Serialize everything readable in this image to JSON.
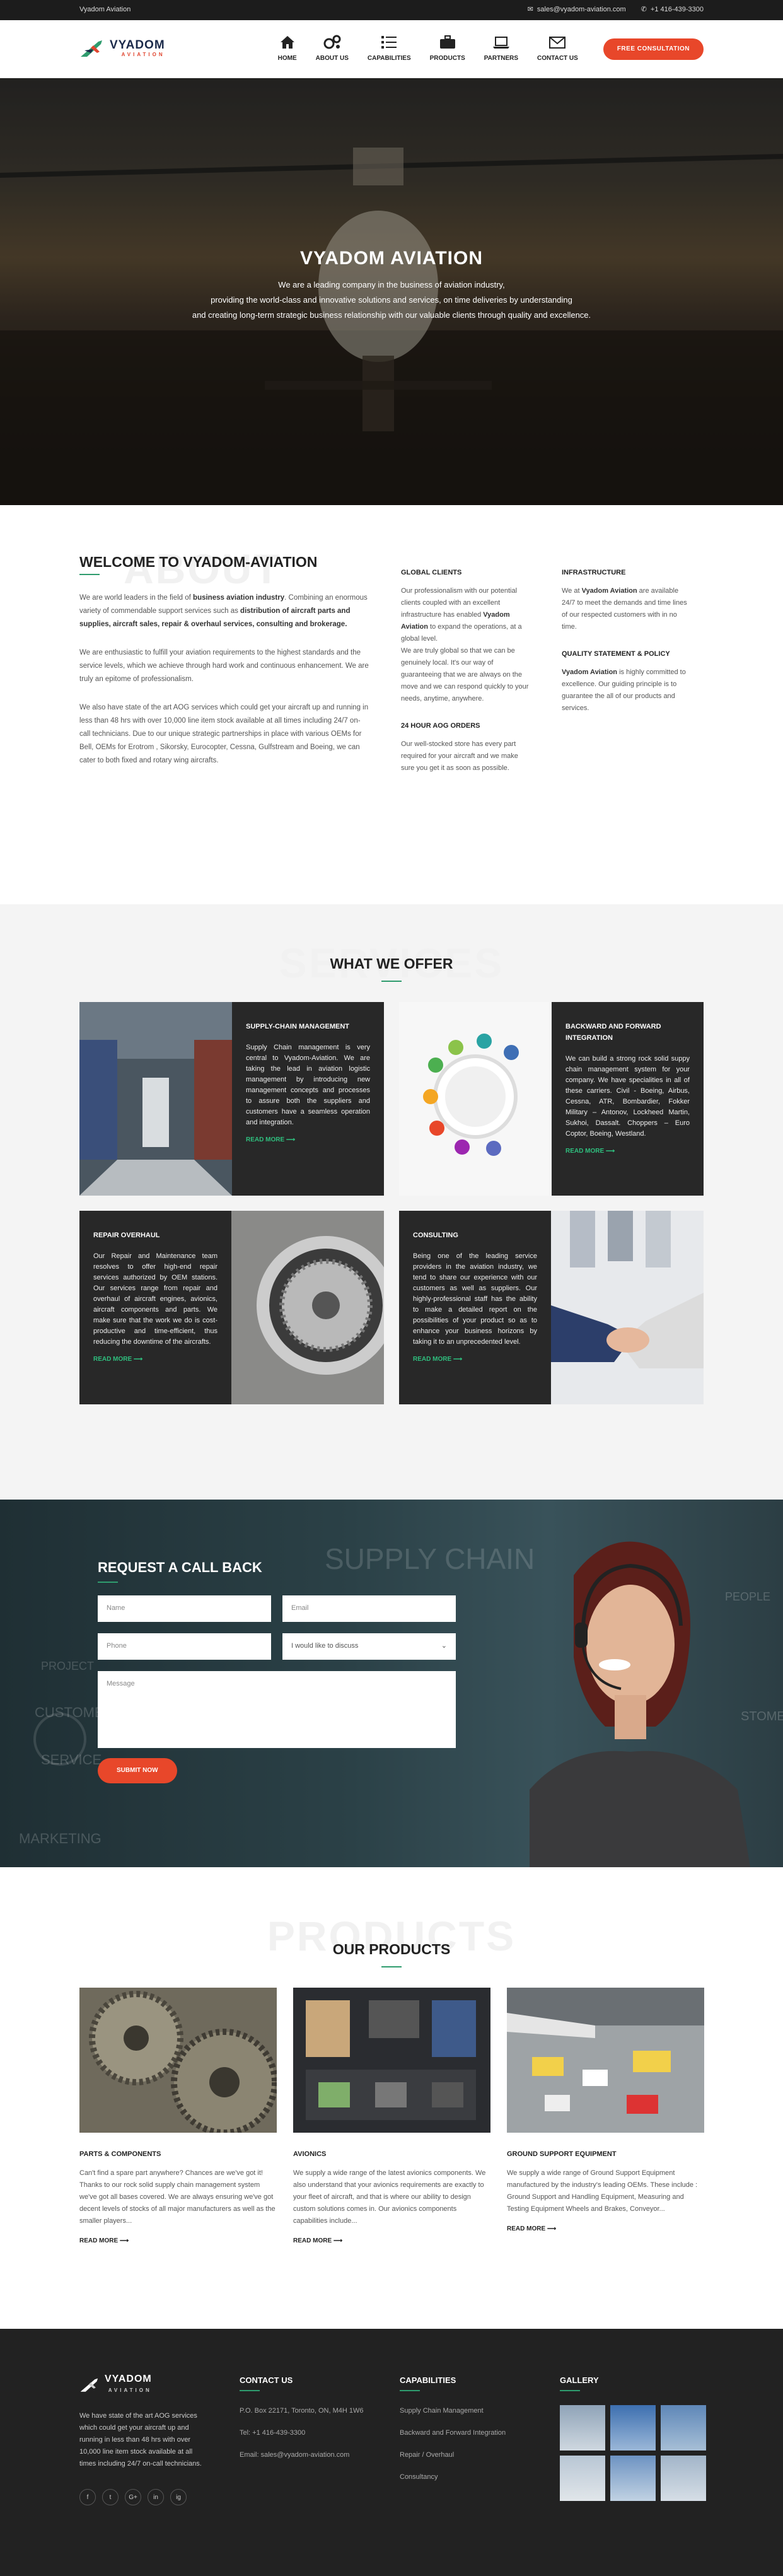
{
  "topbar": {
    "brand": "Vyadom Aviation",
    "email": "sales@vyadom-aviation.com",
    "phone": "+1 416-439-3300"
  },
  "nav": {
    "logo_word": "VYADOM",
    "logo_sub": "AVIATION",
    "items": [
      {
        "label": "HOME",
        "icon": "home-icon"
      },
      {
        "label": "ABOUT US",
        "icon": "gears-icon"
      },
      {
        "label": "CAPABILITIES",
        "icon": "list-icon"
      },
      {
        "label": "PRODUCTS",
        "icon": "briefcase-icon"
      },
      {
        "label": "PARTNERS",
        "icon": "laptop-icon"
      },
      {
        "label": "CONTACT US",
        "icon": "envelope-icon"
      }
    ],
    "cta": "FREE CONSULTATION"
  },
  "hero": {
    "title": "VYADOM AVIATION",
    "line1": "We are a leading company in the business of aviation industry,",
    "line2": "providing the world-class and innovative solutions and services, on time deliveries by understanding",
    "line3": "and creating long-term strategic business relationship with our valuable clients through quality and excellence."
  },
  "welcome": {
    "ghost": "ABOUT",
    "title": "WELCOME TO VYADOM-AVIATION",
    "p1_a": "We are world leaders in the field of ",
    "p1_b": "business aviation industry",
    "p1_c": ". Combining an enormous variety of commendable support services such as ",
    "p1_d": "distribution of aircraft parts and supplies, aircraft sales, repair & overhaul services, consulting and brokerage.",
    "p2": "We are enthusiastic to fulfill your aviation requirements to the highest standards and the service levels, which we achieve through hard work and continuous enhancement. We are truly an epitome of professionalism.",
    "p3": "We also have state of the art AOG services which could get your aircraft up and running in less than 48 hrs with over 10,000 line item stock available at all times including 24/7 on-call technicians. Due to our unique strategic partnerships in place with various OEMs for Bell, OEMs for Erotrom , Sikorsky, Eurocopter, Cessna, Gulfstream and Boeing, we can cater to both fixed and rotary wing aircrafts.",
    "global_title": "GLOBAL CLIENTS",
    "global_a": "Our professionalism with our potential clients coupled with an excellent infrastructure has enabled ",
    "global_b": "Vyadom Aviation",
    "global_c": " to expand the operations, at a global level.",
    "global_d": "We are truly global so that we can be genuinely local. It's our way of guaranteeing that we are always on the move and we can respond quickly to your needs, anytime, anywhere.",
    "aog_title": "24 HOUR AOG ORDERS",
    "aog_text": "Our well-stocked store has every part required for your aircraft and we make sure you get it as soon as possible.",
    "infra_title": "INFRASTRUCTURE",
    "infra_a": "We at ",
    "infra_b": "Vyadom Aviation",
    "infra_c": " are available 24/7 to meet the demands and time lines of our respected customers with in no time.",
    "quality_title": "QUALITY STATEMENT & POLICY",
    "quality_a": "Vyadom Aviation",
    "quality_b": " is highly committed to excellence. Our guiding principle is to guarantee the all of our products and services."
  },
  "services": {
    "ghost": "SERVICES",
    "title": "WHAT WE OFFER",
    "read_more": "READ MORE",
    "items": [
      {
        "title": "SUPPLY-CHAIN MANAGEMENT",
        "text": "Supply Chain management is very central to Vyadom-Aviation. We are taking the lead in aviation logistic management by introducing new management concepts and processes to assure both the suppliers and customers have a seamless operation and integration."
      },
      {
        "title": "BACKWARD AND FORWARD INTEGRATION",
        "text": "We can build a strong rock solid suppy chain management system for your company. We have specialities in all of these carriers. Civil - Boeing, Airbus, Cessna, ATR, Bombardier, Fokker Military – Antonov, Lockheed Martin, Sukhoi, Dassalt. Choppers – Euro Coptor, Boeing, Westland."
      },
      {
        "title": "REPAIR OVERHAUL",
        "text": "Our Repair and Maintenance team resolves to offer high-end repair services authorized by OEM stations. Our services range from repair and overhaul of aircraft engines, avionics, aircraft components and parts. We make sure that the work we do is cost-productive and time-efficient, thus reducing the downtime of the aircrafts."
      },
      {
        "title": "CONSULTING",
        "text": "Being one of the leading service providers in the aviation industry, we tend to share our experience with our customers as well as suppliers. Our highly-professional staff has the ability to make a detailed report on the possibilities of your product so as to enhance your business horizons by taking it to an unprecedented level."
      }
    ]
  },
  "callback": {
    "title": "REQUEST A CALL BACK",
    "name_ph": "Name",
    "email_ph": "Email",
    "phone_ph": "Phone",
    "discuss": "I would like to discuss",
    "message_ph": "Message",
    "submit": "SUBMIT NOW",
    "bg_words": [
      "SUPPLY CHAIN",
      "PROJECT",
      "CUSTOMER",
      "SERVICE",
      "MARKETING",
      "PEOPLE",
      "STOME"
    ]
  },
  "products": {
    "ghost": "PRODUCTS",
    "title": "OUR PRODUCTS",
    "read_more": "READ MORE",
    "items": [
      {
        "title": "PARTS & COMPONENTS",
        "text": "Can't find a spare part anywhere? Chances are we've got it! Thanks to our rock solid supply chain management system we've got all bases covered. We are always ensuring we've got decent levels of stocks of all major manufacturers as well as the smaller players..."
      },
      {
        "title": "AVIONICS",
        "text": "We supply a wide range of the latest avionics components. We also understand that your avionics requirements are exactly to your fleet of aircraft, and that is where our ability to design custom solutions comes in. Our avionics components capabilities include..."
      },
      {
        "title": "GROUND SUPPORT EQUIPMENT",
        "text": "We supply a wide range of Ground Support Equipment manufactured by the industry's leading OEMs. These include : Ground Support and Handling Equipment, Measuring and Testing Equipment Wheels and Brakes, Conveyor..."
      }
    ]
  },
  "footer": {
    "about": "We have state of the art AOG services which could get your aircraft up and running in less than 48 hrs with over 10,000 line item stock available at all times including 24/7 on-call technicians.",
    "social": [
      "f",
      "t",
      "G+",
      "in",
      "ig"
    ],
    "contact_title": "CONTACT US",
    "address": "P.O. Box 22171, Toronto, ON, M4H 1W6",
    "tel": "Tel: +1 416-439-3300",
    "email": "Email: sales@vyadom-aviation.com",
    "cap_title": "CAPABILITIES",
    "caps": [
      "Supply Chain Management",
      "Backward and Forward Integration",
      "Repair / Overhaul",
      "Consultancy"
    ],
    "gallery_title": "GALLERY"
  },
  "colors": {
    "accent": "#e8472a",
    "green": "#2f9c6e",
    "dark": "#282828"
  }
}
